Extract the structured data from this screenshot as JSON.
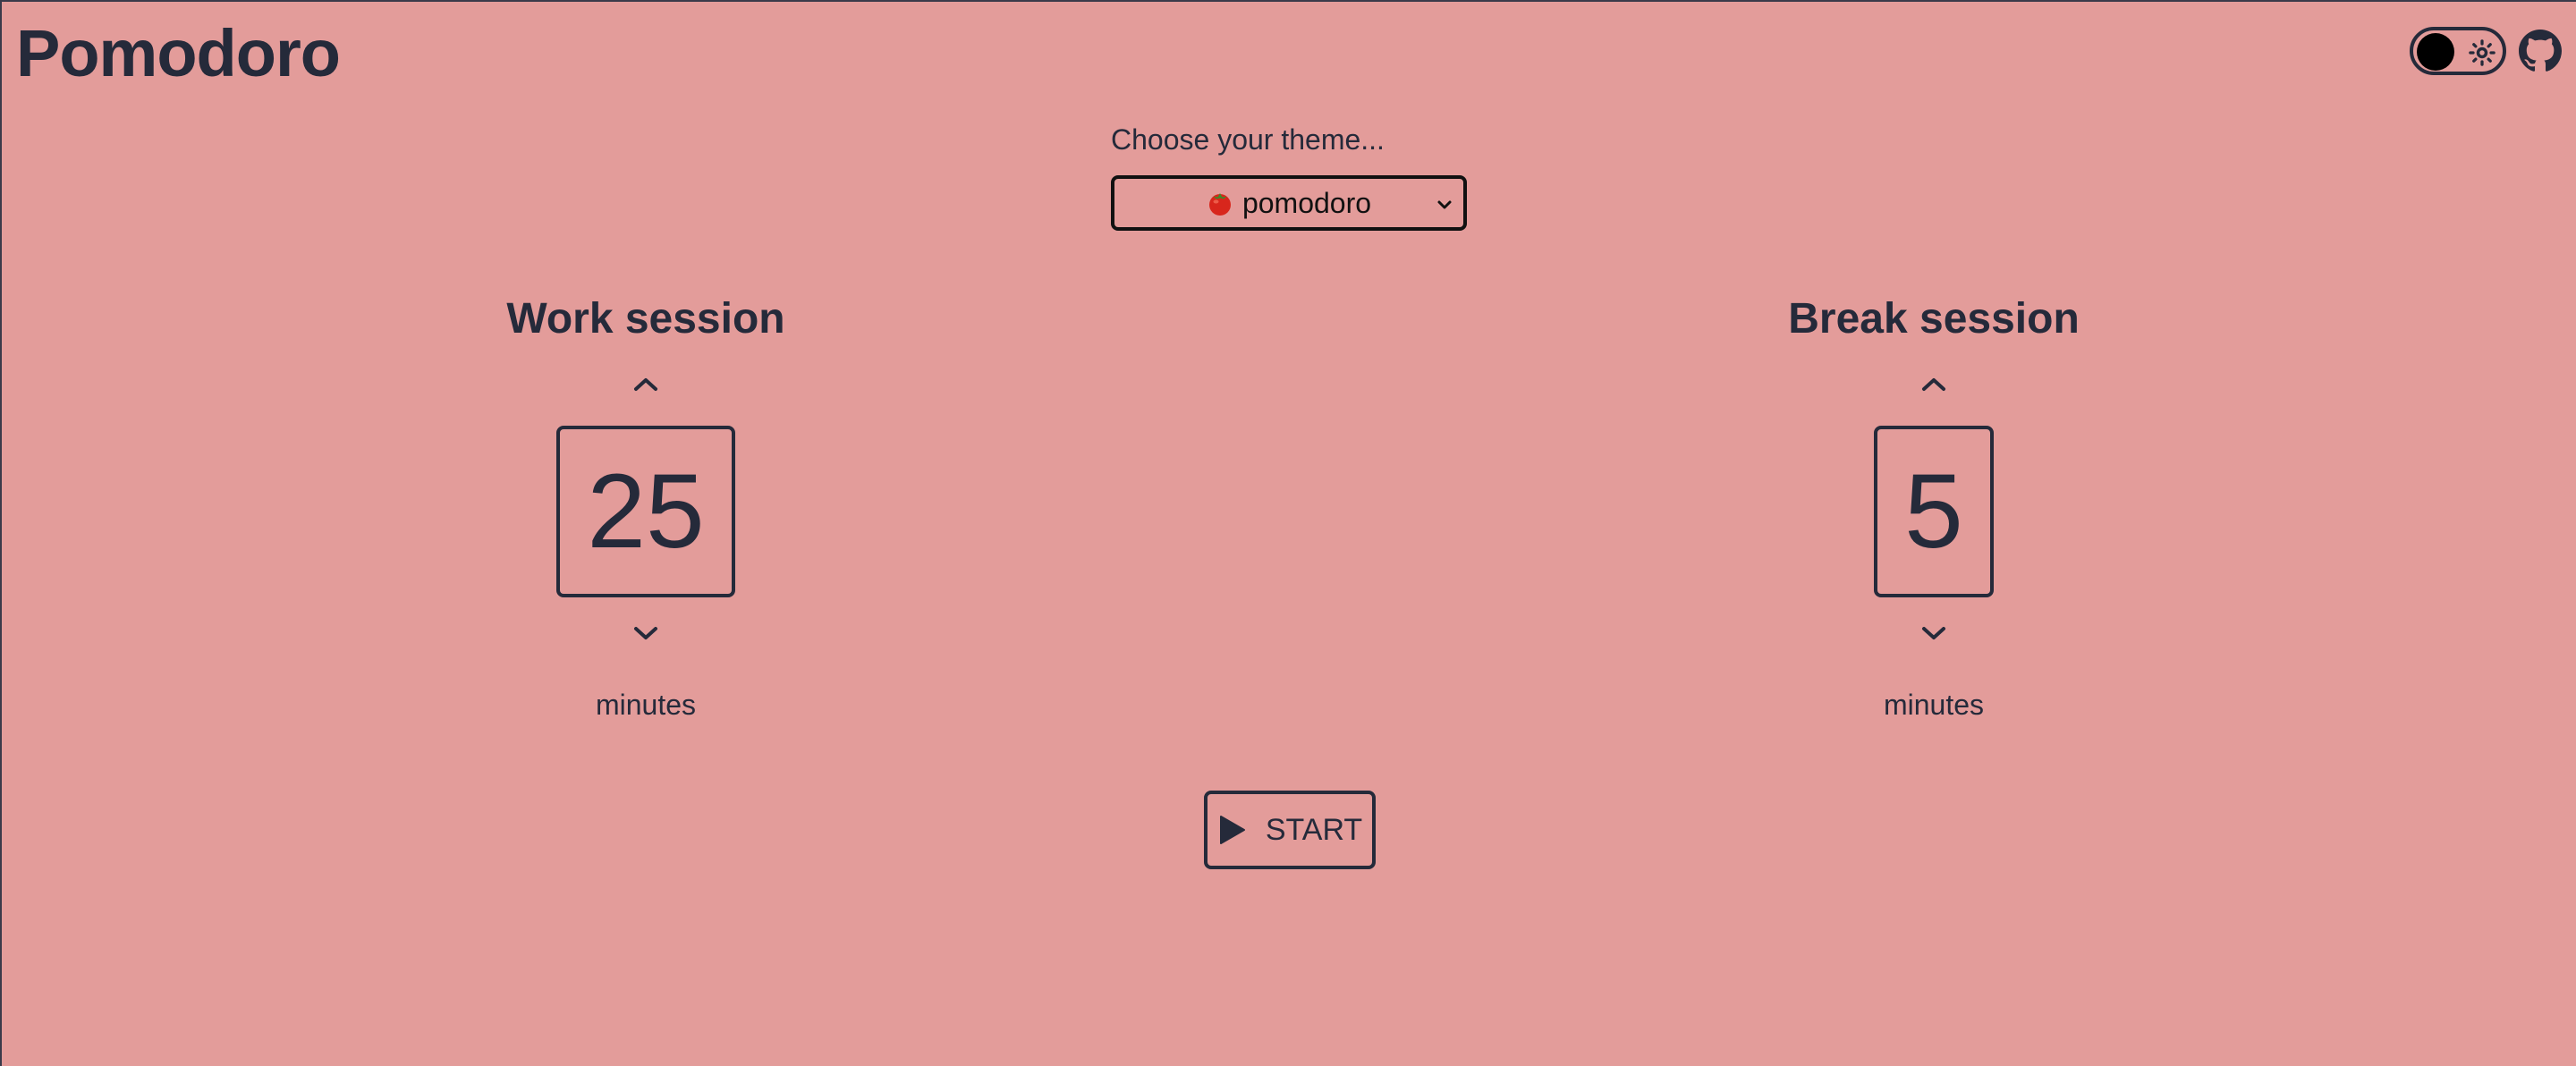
{
  "header": {
    "title": "Pomodoro",
    "theme_toggle_state": "light",
    "sun_icon": "sun-icon",
    "github_icon": "github-icon"
  },
  "theme_picker": {
    "label": "Choose your theme...",
    "selected_icon": "tomato-icon",
    "selected_value": "pomodoro"
  },
  "work_session": {
    "title": "Work session",
    "value": "25",
    "unit": "minutes",
    "increment_icon": "chevron-up-icon",
    "decrement_icon": "chevron-down-icon"
  },
  "break_session": {
    "title": "Break session",
    "value": "5",
    "unit": "minutes",
    "increment_icon": "chevron-up-icon",
    "decrement_icon": "chevron-down-icon"
  },
  "controls": {
    "start_label": "START",
    "start_icon": "play-icon"
  },
  "colors": {
    "background": "#e39c9a",
    "foreground": "#252a3a"
  }
}
